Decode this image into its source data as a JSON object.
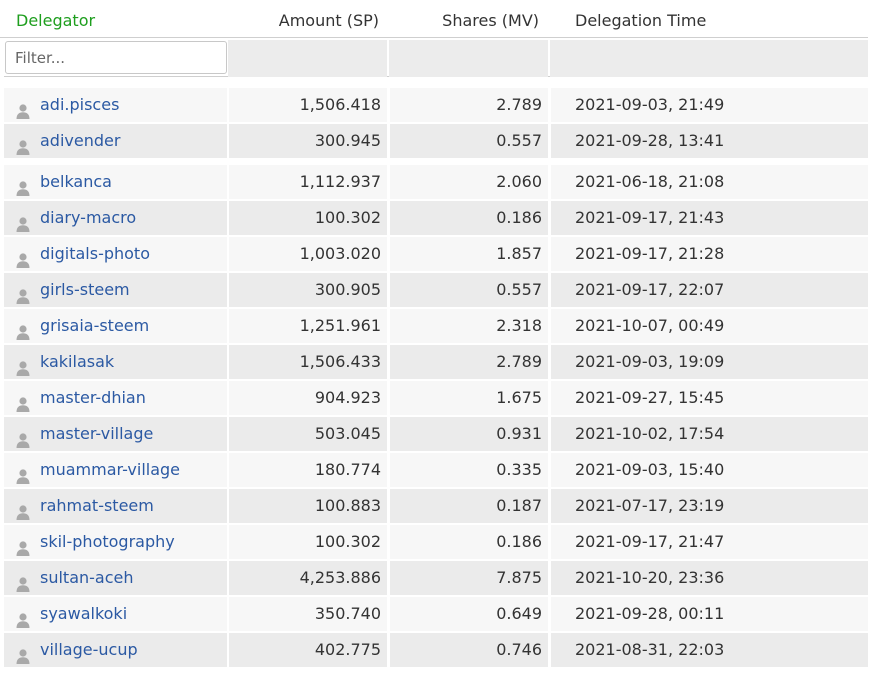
{
  "headers": {
    "delegator": "Delegator",
    "amount": "Amount (SP)",
    "shares": "Shares (MV)",
    "time": "Delegation Time"
  },
  "filter": {
    "placeholder": "Filter...",
    "value": ""
  },
  "accent_color": "#1e9e1e",
  "link_color": "#2b59a3",
  "rows": [
    {
      "name": "adi.pisces",
      "amount": "1,506.418",
      "shares": "2.789",
      "time": "2021-09-03, 21:49"
    },
    {
      "name": "adivender",
      "amount": "300.945",
      "shares": "0.557",
      "time": "2021-09-28, 13:41"
    },
    {
      "name": "belkanca",
      "amount": "1,112.937",
      "shares": "2.060",
      "time": "2021-06-18, 21:08"
    },
    {
      "name": "diary-macro",
      "amount": "100.302",
      "shares": "0.186",
      "time": "2021-09-17, 21:43"
    },
    {
      "name": "digitals-photo",
      "amount": "1,003.020",
      "shares": "1.857",
      "time": "2021-09-17, 21:28"
    },
    {
      "name": "girls-steem",
      "amount": "300.905",
      "shares": "0.557",
      "time": "2021-09-17, 22:07"
    },
    {
      "name": "grisaia-steem",
      "amount": "1,251.961",
      "shares": "2.318",
      "time": "2021-10-07, 00:49"
    },
    {
      "name": "kakilasak",
      "amount": "1,506.433",
      "shares": "2.789",
      "time": "2021-09-03, 19:09"
    },
    {
      "name": "master-dhian",
      "amount": "904.923",
      "shares": "1.675",
      "time": "2021-09-27, 15:45"
    },
    {
      "name": "master-village",
      "amount": "503.045",
      "shares": "0.931",
      "time": "2021-10-02, 17:54"
    },
    {
      "name": "muammar-village",
      "amount": "180.774",
      "shares": "0.335",
      "time": "2021-09-03, 15:40"
    },
    {
      "name": "rahmat-steem",
      "amount": "100.883",
      "shares": "0.187",
      "time": "2021-07-17, 23:19"
    },
    {
      "name": "skil-photography",
      "amount": "100.302",
      "shares": "0.186",
      "time": "2021-09-17, 21:47"
    },
    {
      "name": "sultan-aceh",
      "amount": "4,253.886",
      "shares": "7.875",
      "time": "2021-10-20, 23:36"
    },
    {
      "name": "syawalkoki",
      "amount": "350.740",
      "shares": "0.649",
      "time": "2021-09-28, 00:11"
    },
    {
      "name": "village-ucup",
      "amount": "402.775",
      "shares": "0.746",
      "time": "2021-08-31, 22:03"
    }
  ]
}
